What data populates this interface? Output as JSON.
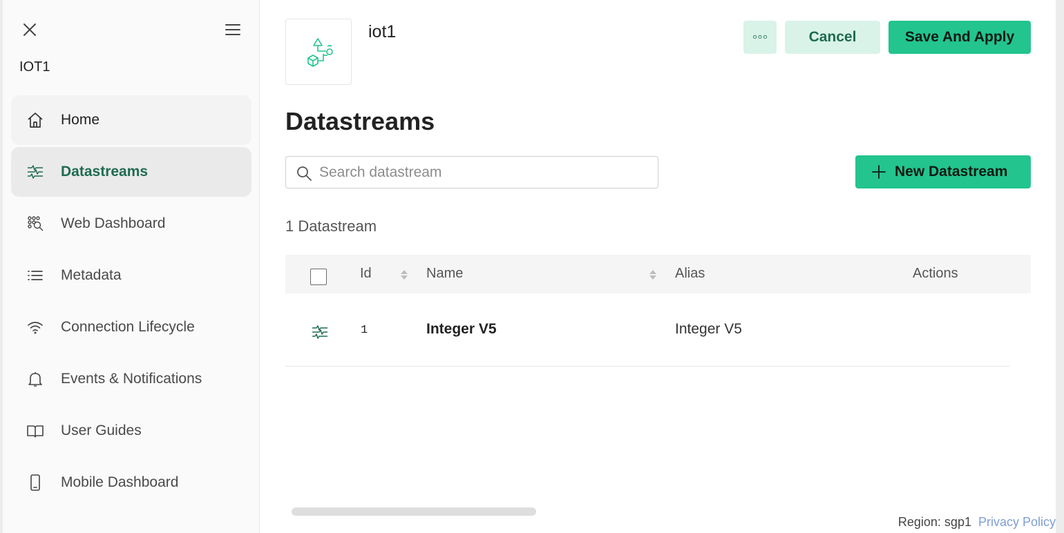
{
  "sidebar": {
    "title": "IOT1",
    "items": [
      {
        "label": "Home",
        "icon": "home-icon"
      },
      {
        "label": "Datastreams",
        "icon": "datastreams-icon",
        "active": true
      },
      {
        "label": "Web Dashboard",
        "icon": "web-dashboard-icon"
      },
      {
        "label": "Metadata",
        "icon": "list-icon"
      },
      {
        "label": "Connection Lifecycle",
        "icon": "wifi-icon"
      },
      {
        "label": "Events & Notifications",
        "icon": "bell-icon"
      },
      {
        "label": "User Guides",
        "icon": "book-icon"
      },
      {
        "label": "Mobile Dashboard",
        "icon": "mobile-icon"
      }
    ]
  },
  "header": {
    "device_name": "iot1",
    "more_label": "◦◦◦",
    "cancel_label": "Cancel",
    "save_label": "Save And Apply"
  },
  "main": {
    "title": "Datastreams",
    "search_placeholder": "Search datastream",
    "new_button_label": "New Datastream",
    "count_text": "1 Datastream",
    "table": {
      "headers": {
        "id": "Id",
        "name": "Name",
        "alias": "Alias",
        "actions": "Actions"
      },
      "rows": [
        {
          "id": "1",
          "name": "Integer V5",
          "alias": "Integer V5"
        }
      ]
    }
  },
  "footer": {
    "region": "Region: sgp1",
    "privacy": "Privacy Policy"
  },
  "colors": {
    "accent": "#23c48e",
    "accent_light": "#d9f3e8",
    "accent_dark": "#1f6b50",
    "link": "#7f9ed6"
  }
}
